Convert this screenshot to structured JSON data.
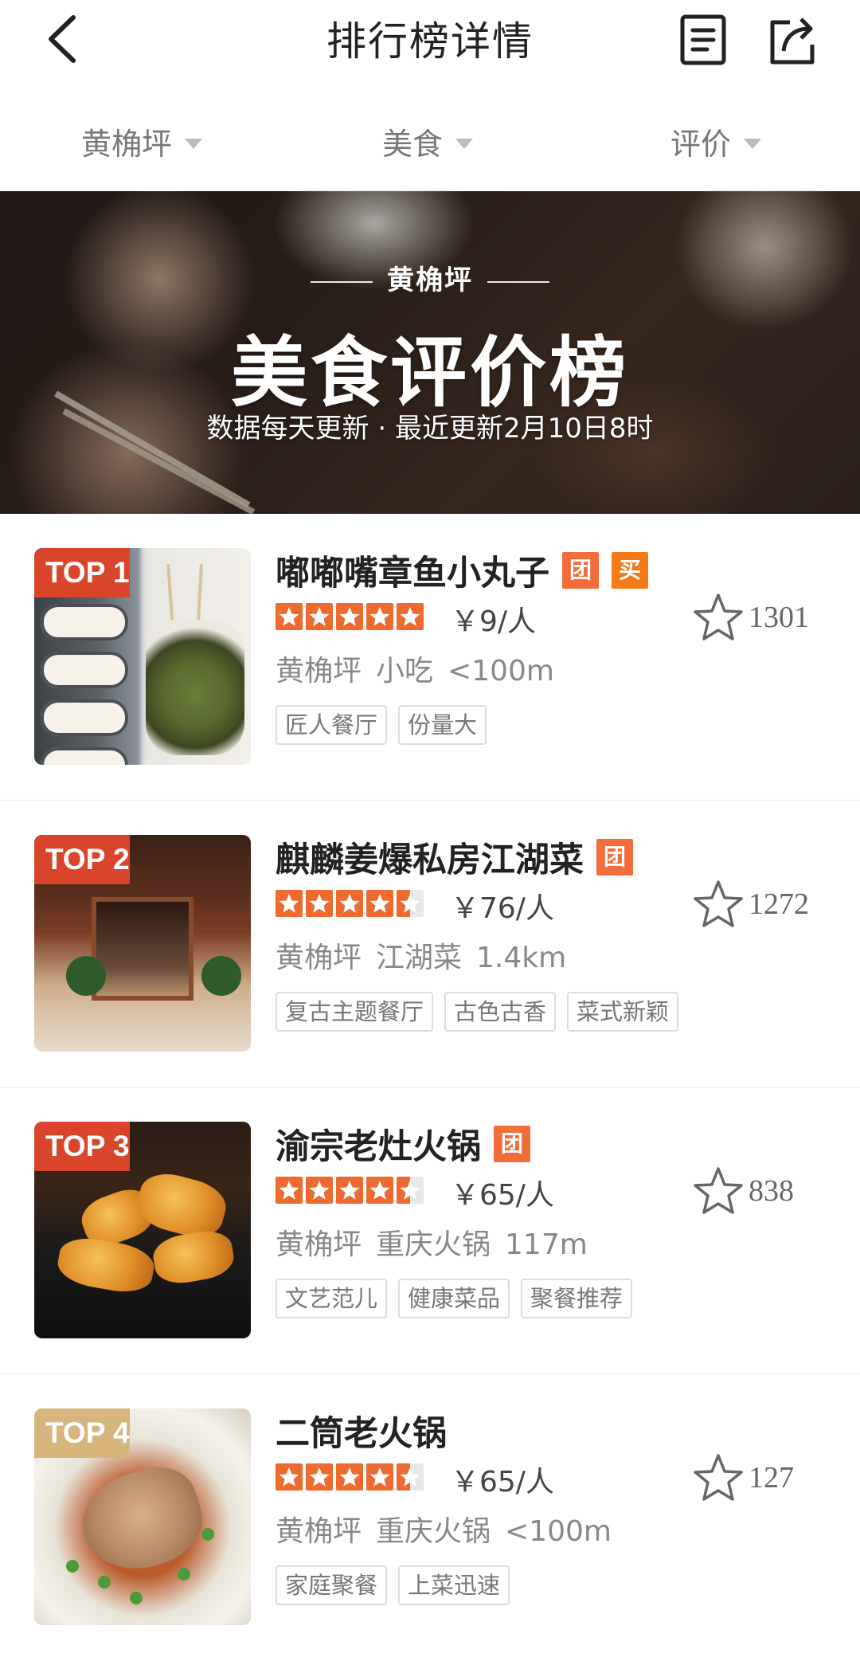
{
  "nav": {
    "title": "排行榜详情"
  },
  "filters": [
    {
      "label": "黄桷坪"
    },
    {
      "label": "美食"
    },
    {
      "label": "评价"
    }
  ],
  "banner": {
    "location": "黄桷坪",
    "title": "美食评价榜",
    "update_text": "数据每天更新 · 最近更新2月10日8时"
  },
  "items": [
    {
      "rank": "TOP 1",
      "name": "嘟嘟嘴章鱼小丸子",
      "badges": [
        "团",
        "买"
      ],
      "rating": 5,
      "price": "￥9/人",
      "favorites": "1301",
      "area": "黄桷坪",
      "category": "小吃",
      "distance": "<100m",
      "tags": [
        "匠人餐厅",
        "份量大"
      ]
    },
    {
      "rank": "TOP 2",
      "name": "麒麟姜爆私房江湖菜",
      "badges": [
        "团"
      ],
      "rating": 4.5,
      "price": "￥76/人",
      "favorites": "1272",
      "area": "黄桷坪",
      "category": "江湖菜",
      "distance": "1.4km",
      "tags": [
        "复古主题餐厅",
        "古色古香",
        "菜式新颖"
      ]
    },
    {
      "rank": "TOP 3",
      "name": "渝宗老灶火锅",
      "badges": [
        "团"
      ],
      "rating": 4.5,
      "price": "￥65/人",
      "favorites": "838",
      "area": "黄桷坪",
      "category": "重庆火锅",
      "distance": "117m",
      "tags": [
        "文艺范儿",
        "健康菜品",
        "聚餐推荐"
      ]
    },
    {
      "rank": "TOP 4",
      "name": "二筒老火锅",
      "badges": [],
      "rating": 4.5,
      "price": "￥65/人",
      "favorites": "127",
      "area": "黄桷坪",
      "category": "重庆火锅",
      "distance": "<100m",
      "tags": [
        "家庭聚餐",
        "上菜迅速"
      ]
    }
  ],
  "colors": {
    "accent": "#f36d3b",
    "star": "#ef6a2f",
    "rank_red": "#d8452a",
    "rank_gold": "#d8b57c"
  },
  "icons": {
    "back": "chevron-left-icon",
    "list": "list-document-icon",
    "share": "share-icon",
    "favorite": "star-outline-icon"
  }
}
